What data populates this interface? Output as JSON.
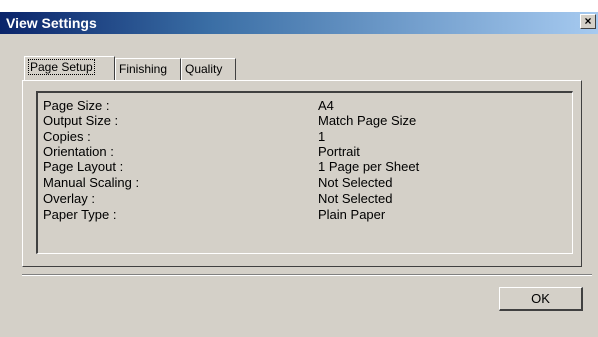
{
  "window": {
    "title": "View Settings",
    "close_glyph": "×"
  },
  "tabs": [
    {
      "label": "Page Setup",
      "active": true
    },
    {
      "label": "Finishing",
      "active": false
    },
    {
      "label": "Quality",
      "active": false
    }
  ],
  "settings": [
    {
      "label": "Page Size :",
      "value": "A4"
    },
    {
      "label": "Output Size :",
      "value": "Match Page Size"
    },
    {
      "label": "Copies :",
      "value": "1"
    },
    {
      "label": "Orientation :",
      "value": "Portrait"
    },
    {
      "label": "Page Layout :",
      "value": "1 Page per Sheet"
    },
    {
      "label": "Manual Scaling :",
      "value": "Not Selected"
    },
    {
      "label": "Overlay :",
      "value": "Not Selected"
    },
    {
      "label": "Paper Type :",
      "value": "Plain Paper"
    }
  ],
  "buttons": {
    "ok_label": "OK"
  },
  "colors": {
    "titlebar_start": "#0a246a",
    "titlebar_end": "#a6caf0",
    "face": "#d4d0c8"
  }
}
